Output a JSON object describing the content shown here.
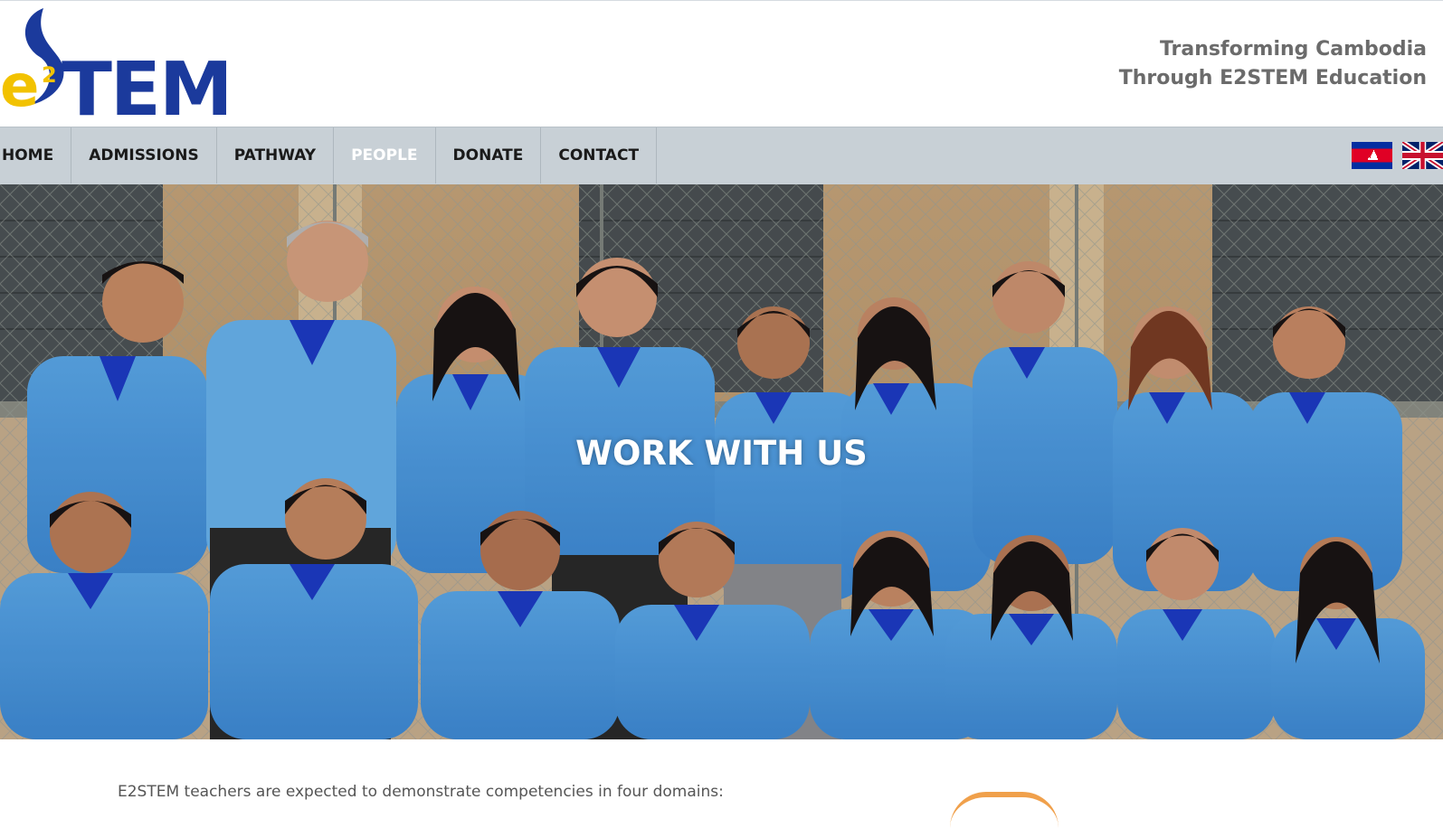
{
  "header": {
    "logo": {
      "sup": "2",
      "letter": "e",
      "text": "TEM"
    },
    "tagline_line1": "Transforming Cambodia",
    "tagline_line2": "Through E2STEM Education"
  },
  "nav": {
    "items": [
      {
        "label": "HOME",
        "active": false
      },
      {
        "label": "ADMISSIONS",
        "active": false
      },
      {
        "label": "PATHWAY",
        "active": false
      },
      {
        "label": "PEOPLE",
        "active": true
      },
      {
        "label": "DONATE",
        "active": false
      },
      {
        "label": "CONTACT",
        "active": false
      }
    ],
    "flags": [
      "cambodia-flag-icon",
      "uk-flag-icon"
    ]
  },
  "hero": {
    "title": "WORK WITH US",
    "image": "group-photo-of-staff-in-blue-polo-shirts"
  },
  "content": {
    "intro": "E2STEM teachers are expected to demonstrate competencies in four domains:"
  },
  "colors": {
    "brand_blue": "#1b3a9c",
    "brand_yellow": "#f2c200",
    "nav_bg": "#c8d0d6",
    "shirt_blue": "#4f9fe3",
    "collar_blue": "#1d3bc6",
    "accent_orange": "#f0a04b"
  }
}
